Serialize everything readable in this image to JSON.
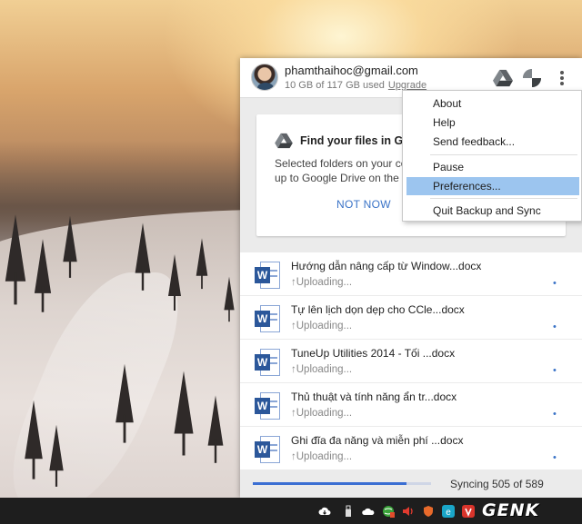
{
  "account": {
    "email": "phamthaihoc@gmail.com",
    "usage": "10 GB of 117 GB used",
    "upgrade_label": "Upgrade"
  },
  "header_icons": [
    "google-drive-icon",
    "google-photos-icon",
    "more-vert-icon"
  ],
  "card": {
    "title": "Find your files in Goo",
    "body_line1": "Selected folders on your co",
    "body_line2": "up to Google Drive on the C",
    "not_now_label": "NOT NOW"
  },
  "menu": {
    "items": [
      "About",
      "Help",
      "Send feedback...",
      "Pause",
      "Preferences...",
      "Quit Backup and Sync"
    ],
    "selected": "Preferences..."
  },
  "files": [
    {
      "name": "Hướng dẫn nâng cấp từ Window...docx",
      "status": "Uploading..."
    },
    {
      "name": "Tự lên lịch dọn dẹp cho CCle...docx",
      "status": "Uploading..."
    },
    {
      "name": "TuneUp Utilities 2014 - Tối ...docx",
      "status": "Uploading..."
    },
    {
      "name": "Thủ thuật và tính năng ẩn tr...docx",
      "status": "Uploading..."
    },
    {
      "name": "Ghi đĩa đa năng và miễn phí ...docx",
      "status": "Uploading..."
    }
  ],
  "upload_arrow": "↑",
  "row_dot": "•",
  "sync": {
    "text": "Syncing 505 of 589",
    "progress_fraction": 0.86
  },
  "file_icon_letter": "W",
  "watermark": {
    "prefix": "GEN",
    "suffix": "K"
  },
  "colors": {
    "accent_blue": "#3a73c7",
    "progress_blue": "#3b6fd3",
    "menu_selected": "#9cc5ef",
    "word_blue": "#2b579a"
  }
}
